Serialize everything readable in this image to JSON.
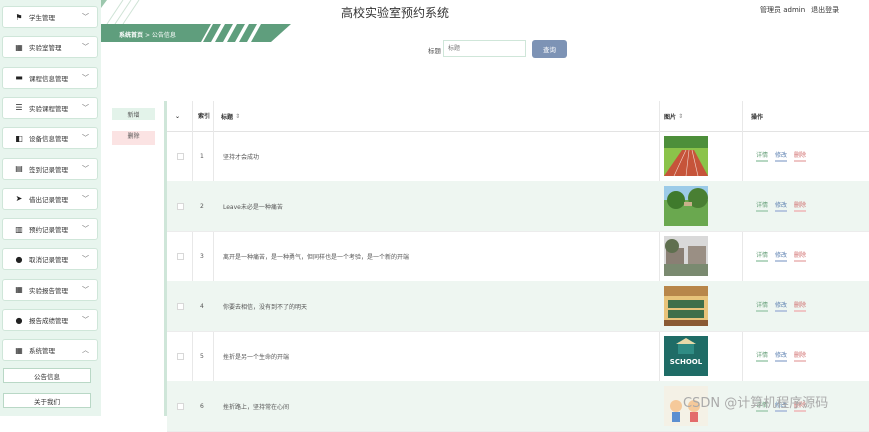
{
  "app_title": "高校实验室预约系统",
  "header": {
    "user_label": "管理员 admin",
    "logout": "退出登录"
  },
  "breadcrumb": {
    "home": "系统首页",
    "sep": ">",
    "current": "公告信息"
  },
  "sidebar": {
    "items": [
      {
        "label": "学生管理",
        "icon": "flag-icon",
        "glyph": "⚑"
      },
      {
        "label": "实验室管理",
        "icon": "grid-icon",
        "glyph": "▦"
      },
      {
        "label": "课程信息管理",
        "icon": "folder-icon",
        "glyph": "▬"
      },
      {
        "label": "实验课程管理",
        "icon": "sliders-icon",
        "glyph": "☰"
      },
      {
        "label": "设备信息管理",
        "icon": "truck-icon",
        "glyph": "◧"
      },
      {
        "label": "签到记录管理",
        "icon": "calendar-icon",
        "glyph": "▤"
      },
      {
        "label": "借出记录管理",
        "icon": "send-icon",
        "glyph": "➤"
      },
      {
        "label": "预约记录管理",
        "icon": "chart-icon",
        "glyph": "▥"
      },
      {
        "label": "取消记录管理",
        "icon": "user-icon",
        "glyph": "●"
      },
      {
        "label": "实验报告管理",
        "icon": "grid-icon",
        "glyph": "▦"
      },
      {
        "label": "报告成绩管理",
        "icon": "user-icon",
        "glyph": "●"
      },
      {
        "label": "系统管理",
        "icon": "grid-icon",
        "glyph": "▦"
      }
    ],
    "sub_items": [
      {
        "label": "公告信息"
      },
      {
        "label": "关于我们"
      }
    ]
  },
  "search": {
    "label": "标题",
    "placeholder": "标题",
    "button": "查询"
  },
  "actions": {
    "add": "新增",
    "delete": "删除"
  },
  "table": {
    "headers": {
      "index": "索引",
      "title": "标题",
      "image": "图片",
      "ops": "操作"
    },
    "sort_icon": "⇕",
    "op_labels": {
      "detail": "详情",
      "edit": "修改",
      "delete": "删除"
    },
    "rows": [
      {
        "index": "1",
        "title": "坚持才会成功",
        "image": "running-track"
      },
      {
        "index": "2",
        "title": "Leave未必是一种痛苦",
        "image": "campus-lawn"
      },
      {
        "index": "3",
        "title": "离开是一种痛苦，是一种勇气，但同样也是一个考验，是一个新的开端",
        "image": "campus-buildings"
      },
      {
        "index": "4",
        "title": "你要去相信，没有到不了的明天",
        "image": "library-hall"
      },
      {
        "index": "5",
        "title": "挫折是另一个生命的开端",
        "image": "school-sign"
      },
      {
        "index": "6",
        "title": "挫折路上，坚持常在心间",
        "image": "cartoon-kids"
      }
    ]
  },
  "watermark": "CSDN @计算机程序源码"
}
